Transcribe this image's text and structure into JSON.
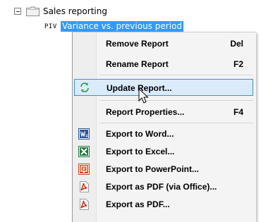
{
  "tree": {
    "root_label": "Sales reporting",
    "child_tag": "PIV",
    "child_label": "Variance vs. previous period"
  },
  "menu": {
    "items": [
      {
        "label": "Remove Report",
        "shortcut": "Del"
      },
      {
        "label": "Rename Report",
        "shortcut": "F2"
      },
      {
        "label": "Update Report...",
        "shortcut": "",
        "icon": "refresh-icon"
      },
      {
        "label": "Report Properties...",
        "shortcut": "F4"
      },
      {
        "label": "Export to Word...",
        "shortcut": "",
        "icon": "word-icon"
      },
      {
        "label": "Export to Excel...",
        "shortcut": "",
        "icon": "excel-icon"
      },
      {
        "label": "Export to PowerPoint...",
        "shortcut": "",
        "icon": "powerpoint-icon"
      },
      {
        "label": "Export as PDF (via Office)...",
        "shortcut": "",
        "icon": "pdf-icon"
      },
      {
        "label": "Export as PDF...",
        "shortcut": "",
        "icon": "pdf-icon"
      }
    ]
  },
  "colors": {
    "selection": "#3399ff",
    "hover_bg": "#dcebfc",
    "hover_border": "#3d8ee6",
    "word": "#2a5699",
    "excel": "#1f7a3f",
    "powerpoint": "#d24726",
    "pdf": "#d81e05"
  }
}
